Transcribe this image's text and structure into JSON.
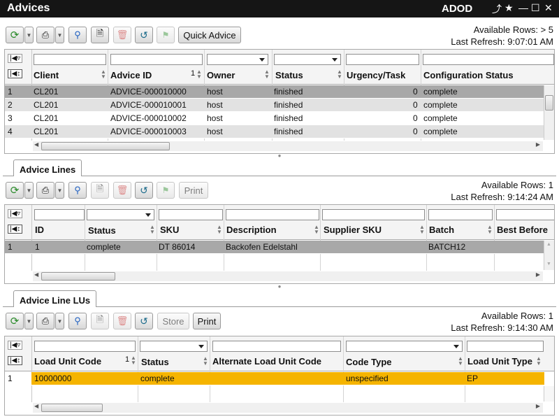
{
  "window": {
    "title": "Advices",
    "app": "ADOD"
  },
  "advices": {
    "available_rows": "Available Rows: > 5",
    "last_refresh": "Last Refresh: 9:07:01 AM",
    "quick_advice_label": "Quick Advice",
    "columns": [
      "Client",
      "Advice ID",
      "Owner",
      "Status",
      "Urgency/Task",
      "Configuration Status"
    ],
    "sort_index": "1",
    "rows": [
      {
        "n": "1",
        "client": "CL201",
        "advice_id": "ADVICE-000010000",
        "owner": "host",
        "status": "finished",
        "urgency": "0",
        "config": "complete"
      },
      {
        "n": "2",
        "client": "CL201",
        "advice_id": "ADVICE-000010001",
        "owner": "host",
        "status": "finished",
        "urgency": "0",
        "config": "complete"
      },
      {
        "n": "3",
        "client": "CL201",
        "advice_id": "ADVICE-000010002",
        "owner": "host",
        "status": "finished",
        "urgency": "0",
        "config": "complete"
      },
      {
        "n": "4",
        "client": "CL201",
        "advice_id": "ADVICE-000010003",
        "owner": "host",
        "status": "finished",
        "urgency": "0",
        "config": "complete"
      }
    ]
  },
  "advice_lines": {
    "tab": "Advice Lines",
    "available_rows": "Available Rows: 1",
    "last_refresh": "Last Refresh: 9:14:24 AM",
    "print_label": "Print",
    "columns": [
      "ID",
      "Status",
      "SKU",
      "Description",
      "Supplier SKU",
      "Batch",
      "Best Before"
    ],
    "rows": [
      {
        "n": "1",
        "id": "1",
        "status": "complete",
        "sku": "DT 86014",
        "description": "Backofen Edelstahl",
        "supplier_sku": "",
        "batch": "BATCH12",
        "best_before": ""
      }
    ]
  },
  "advice_line_lus": {
    "tab": "Advice Line LUs",
    "available_rows": "Available Rows: 1",
    "last_refresh": "Last Refresh: 9:14:30 AM",
    "store_label": "Store",
    "print_label": "Print",
    "columns": [
      "Load Unit Code",
      "Status",
      "Alternate Load Unit Code",
      "Code Type",
      "Load Unit Type"
    ],
    "sort_index": "1",
    "rows": [
      {
        "n": "1",
        "lu_code": "10000000",
        "status": "complete",
        "alt_code": "",
        "code_type": "unspecified",
        "lu_type": "EP"
      }
    ]
  },
  "colors": {
    "selected_row": "#a8a8a8",
    "alt_row": "#e2e2e2",
    "highlight_row": "#f5b400",
    "titlebar": "#151515"
  }
}
